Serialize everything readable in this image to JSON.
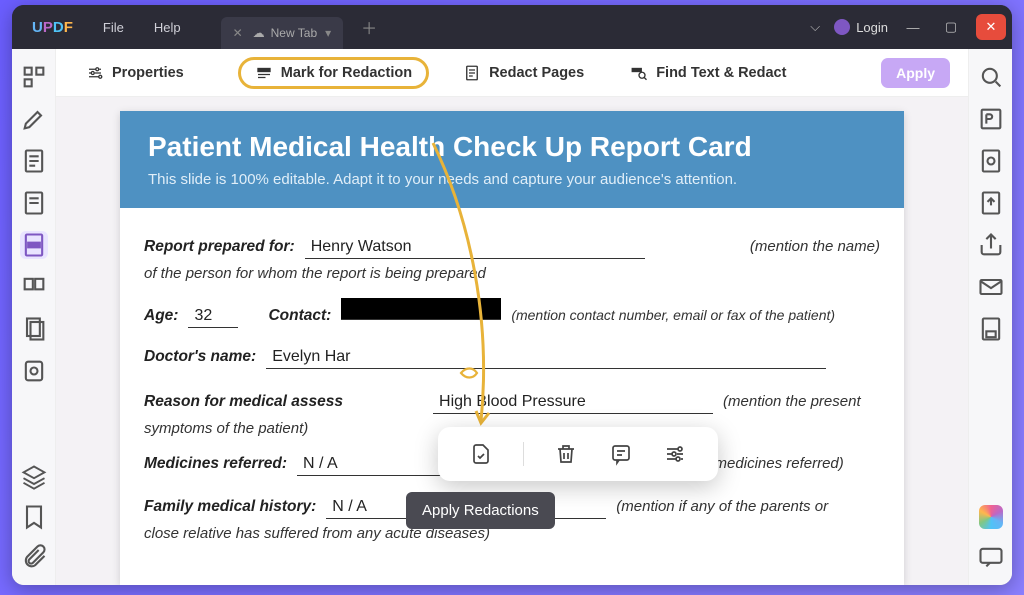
{
  "titlebar": {
    "logo": "UPDF",
    "menu": {
      "file": "File",
      "help": "Help"
    },
    "tab_label": "New Tab",
    "login": "Login"
  },
  "toolbar": {
    "properties": "Properties",
    "mark": "Mark for Redaction",
    "redact_pages": "Redact Pages",
    "find": "Find Text & Redact",
    "apply": "Apply"
  },
  "tooltip": "Apply Redactions",
  "doc": {
    "title": "Patient Medical Health Check Up Report Card",
    "subtitle": "This slide is 100% editable. Adapt it to your needs and capture your audience's attention.",
    "labels": {
      "report_prepared_for": "Report prepared for:",
      "age": "Age:",
      "contact": "Contact:",
      "doctor": "Doctor's name:",
      "reason": "Reason for medical assess",
      "medicines": "Medicines referred:",
      "family": "Family medical history:"
    },
    "values": {
      "prepared_for": "Henry Watson",
      "age": "32",
      "doctor": "Evelyn  Har",
      "reason": "High Blood Pressure",
      "medicines": "N / A",
      "family": "N / A"
    },
    "hints": {
      "prepared_for": "(mention the name)",
      "prepared_for_sub": "of the person for whom the report is being prepared",
      "contact": "(mention contact number, email or fax of the patient)",
      "reason": "(mention the present",
      "reason_sub": "symptoms of the patient)",
      "medicines": "(name of all the medicines referred)",
      "family": "(mention if any of the parents or",
      "family_sub": "close relative has suffered from any acute diseases)"
    }
  }
}
